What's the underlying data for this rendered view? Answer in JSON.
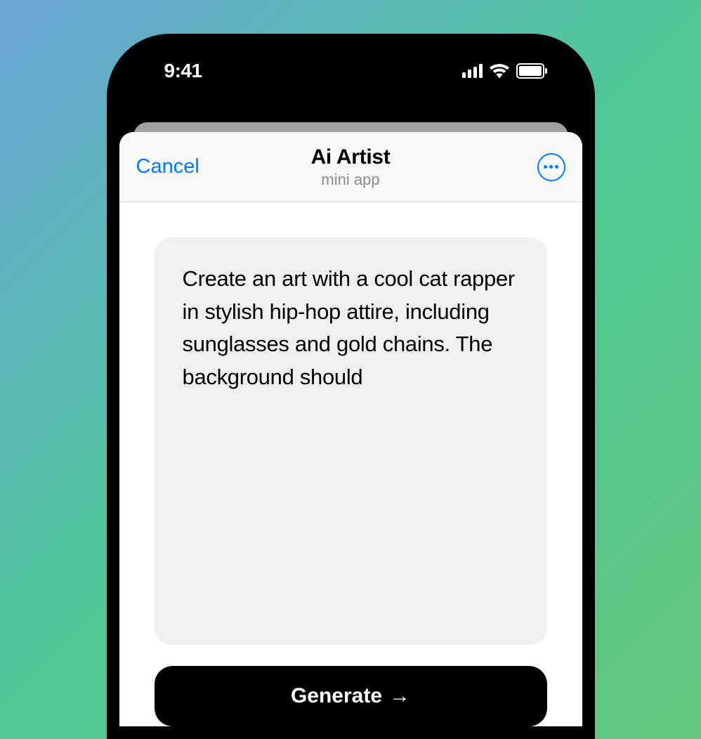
{
  "status_bar": {
    "time": "9:41"
  },
  "sheet": {
    "cancel_label": "Cancel",
    "title": "Ai Artist",
    "subtitle": "mini app"
  },
  "main": {
    "prompt_text": "Create an art with a cool cat rapper in stylish hip-hop attire, including sunglasses and gold chains. The background should",
    "generate_label": "Generate"
  }
}
